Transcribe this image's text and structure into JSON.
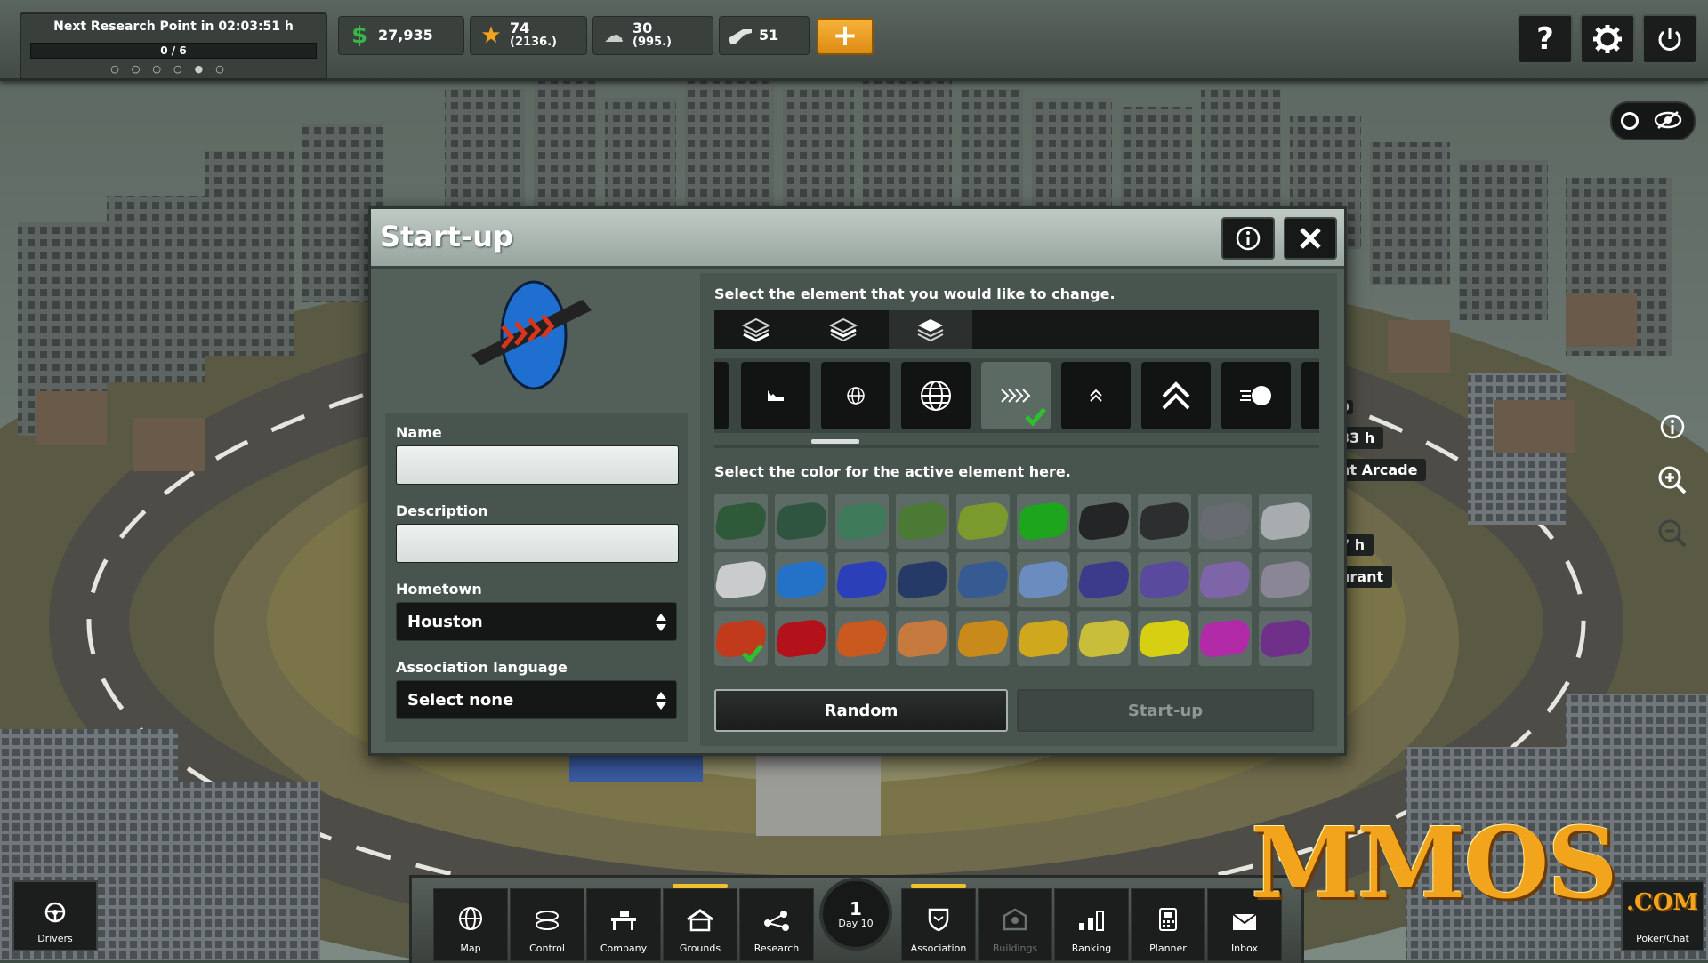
{
  "topbar": {
    "research_title": "Next Research Point in 02:03:51 h",
    "research_progress": "0 / 6",
    "research_dots": "○○○○●○",
    "money": "27,935",
    "reputation": "74",
    "reputation_sub": "(2136.)",
    "followers": "30",
    "followers_sub": "(995.)",
    "weapons": "51",
    "plus_label": "+",
    "help_icon": "question-icon",
    "settings_icon": "gear-icon",
    "power_icon": "power-icon"
  },
  "map_labels": {
    "label1": "00",
    "label2": "33 h",
    "label3": "nt Arcade",
    "label4": "0",
    "label5": "7 h",
    "label6": "urant"
  },
  "dialog": {
    "title": "Start-up",
    "name_label": "Name",
    "name_value": "",
    "description_label": "Description",
    "description_value": "",
    "hometown_label": "Hometown",
    "hometown_value": "Houston",
    "language_label": "Association language",
    "language_value": "Select none",
    "element_prompt": "Select the element that you would like to change.",
    "color_prompt": "Select the color for the active element here.",
    "random_label": "Random",
    "startup_label": "Start-up",
    "layer_tabs": [
      "layer-bottom",
      "layer-middle",
      "layer-top"
    ],
    "active_layer": 2,
    "elements": [
      "partial",
      "wave-shape",
      "globe-small",
      "globe-large",
      "chevrons",
      "chevron-up-small",
      "chevron-up-large",
      "dot-comet",
      "partial"
    ],
    "active_element": 4,
    "swatch_colors": [
      [
        "#2e5a3a",
        "#2f5541",
        "#3f7a5b",
        "#4a7a33",
        "#7a9a2e",
        "#1ea51e",
        "#232526",
        "#2c2e30",
        "#686c72",
        "#a9acae"
      ],
      [
        "#c9cbcd",
        "#2472c8",
        "#2a3fb8",
        "#253a66",
        "#365a92",
        "#6b8cbe",
        "#3c3a8a",
        "#5a4a9e",
        "#7e65a8",
        "#8b8696"
      ],
      [
        "#c23a1c",
        "#b3121a",
        "#c9591e",
        "#c77a3e",
        "#c88a1a",
        "#cfa81e",
        "#c8be3a",
        "#d7cf12",
        "#b22aa8",
        "#6e3088"
      ]
    ],
    "selected_swatch": [
      2,
      0
    ]
  },
  "bottombar": {
    "items": [
      {
        "label": "Map",
        "icon": "globe-icon"
      },
      {
        "label": "Control",
        "icon": "control-icon"
      },
      {
        "label": "Company",
        "icon": "desk-icon"
      },
      {
        "label": "Grounds",
        "icon": "house-icon"
      },
      {
        "label": "Research",
        "icon": "network-icon"
      },
      {
        "label": "Association",
        "icon": "shield-icon"
      },
      {
        "label": "Buildings",
        "icon": "building-icon"
      },
      {
        "label": "Ranking",
        "icon": "ranking-icon"
      },
      {
        "label": "Planner",
        "icon": "planner-icon"
      },
      {
        "label": "Inbox",
        "icon": "mail-icon"
      }
    ],
    "day_number": "1",
    "day_label": "Day 10",
    "drivers_label": "Drivers",
    "chat_label": "Poker/Chat"
  },
  "watermark": {
    "text": "MMOS",
    "suffix": ".COM"
  },
  "colors": {
    "accent_orange": "#f2a51c",
    "panel": "#48544e",
    "header": "#a8b5ae"
  }
}
